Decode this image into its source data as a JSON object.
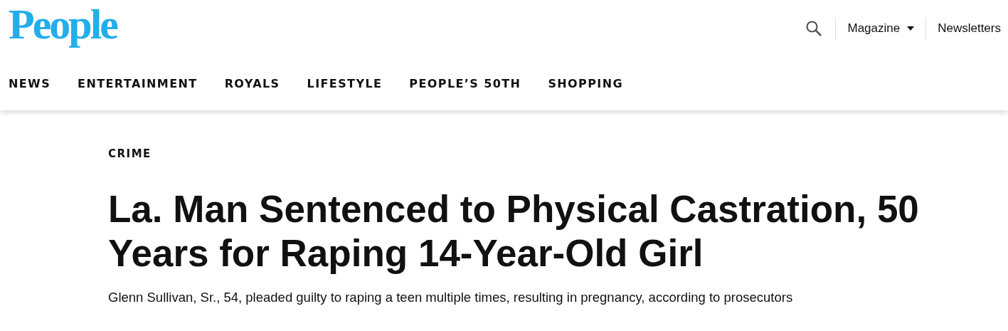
{
  "header": {
    "logo": "People",
    "search": {
      "kind": "search"
    },
    "links": [
      {
        "label": "Magazine",
        "dropdown": true
      },
      {
        "label": "Newsletters",
        "dropdown": false
      }
    ]
  },
  "nav": [
    "NEWS",
    "ENTERTAINMENT",
    "ROYALS",
    "LIFESTYLE",
    "PEOPLE’S 50TH",
    "SHOPPING"
  ],
  "article": {
    "category": "CRIME",
    "title": "La. Man Sentenced to Physical Castration, 50 Years for Raping 14-Year-Old Girl",
    "subtitle": "Glenn Sullivan, Sr., 54, pleaded guilty to raping a teen multiple times, resulting in pregnancy, according to prosecutors"
  }
}
